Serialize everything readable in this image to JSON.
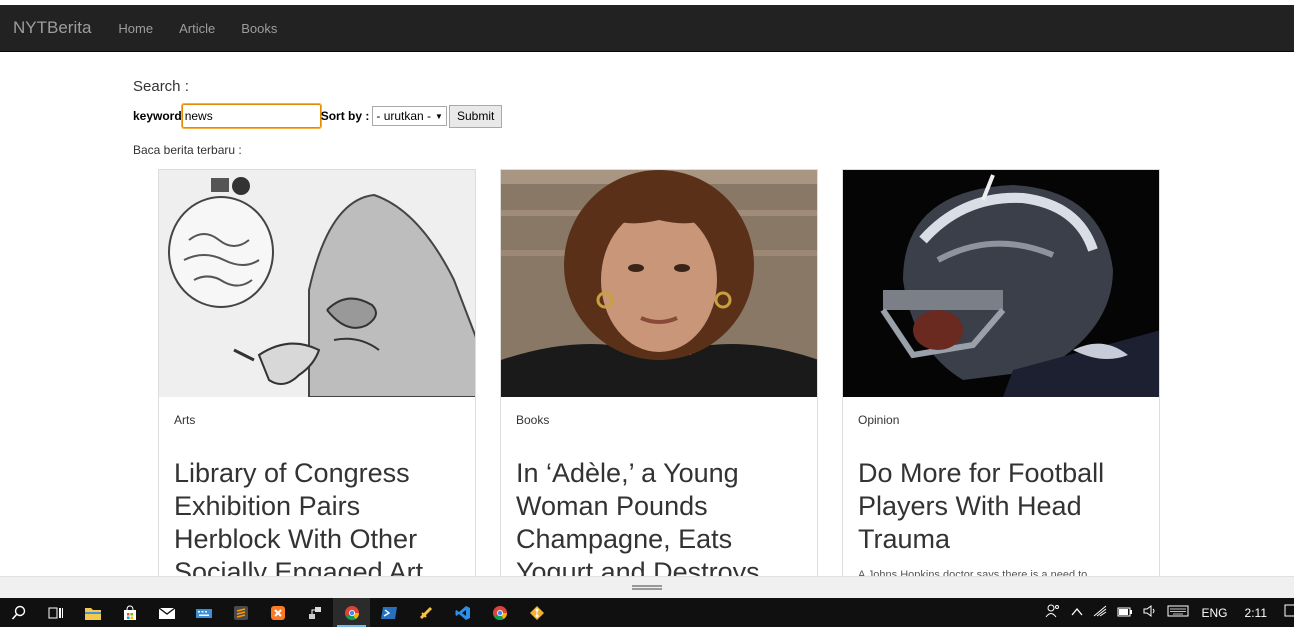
{
  "navbar": {
    "brand": "NYTBerita",
    "links": [
      "Home",
      "Article",
      "Books"
    ]
  },
  "search": {
    "title": "Search :",
    "keyword_label": "keyword",
    "keyword_value": "news",
    "sort_label": "Sort by :",
    "sort_selected": "- urutkan -",
    "submit_label": "Submit"
  },
  "intro_text": "Baca berita terbaru :",
  "articles": [
    {
      "category": "Arts",
      "title": "Library of Congress Exhibition Pairs Herblock With Other Socially Engaged Art",
      "image_icon": "cartoon-illustration"
    },
    {
      "category": "Books",
      "title": "In ‘Adèle,’ a Young Woman Pounds Champagne, Eats Yogurt and Destroys",
      "image_icon": "portrait-photo"
    },
    {
      "category": "Opinion",
      "title": "Do More for Football Players With Head Trauma",
      "description": "A Johns Hopkins doctor says there is a need to",
      "image_icon": "football-helmet-photo"
    }
  ],
  "taskbar": {
    "language": "ENG",
    "time": "2:11"
  },
  "colors": {
    "navbar_bg": "#222222",
    "navbar_text": "#9d9d9d",
    "input_focus": "#e58a00",
    "taskbar_bg": "#101010",
    "taskbar_accent": "#76b9ed"
  }
}
